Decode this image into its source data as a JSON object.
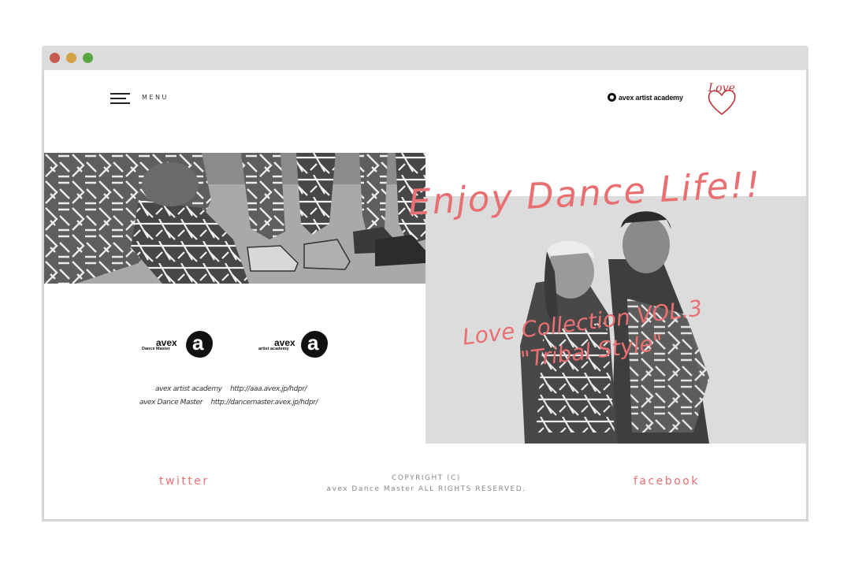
{
  "header": {
    "menu_label": "MENU",
    "brand_text": "avex artist academy",
    "love_logo_text": "Love"
  },
  "hero": {
    "headline": "Enjoy Dance Life!!",
    "collection_line1": "Love Collection VOL.3",
    "collection_line2": "\"Tribal Style\""
  },
  "brands": {
    "dance_master": {
      "word": "avex",
      "sub": "Dance Master",
      "mark": "a"
    },
    "artist_academy": {
      "word": "avex",
      "sub": "artist academy",
      "mark": "a"
    }
  },
  "links": {
    "academy": {
      "name": "avex artist academy",
      "url": "http://aaa.avex.jp/hdpr/"
    },
    "dance_master": {
      "name": "avex Dance Master",
      "url": "http://dancemaster.avex.jp/hdpr/"
    }
  },
  "footer": {
    "twitter": "twitter",
    "facebook": "facebook",
    "copyright_line1": "COPYRIGHT (C)",
    "copyright_line2": "avex Dance Master ALL RIGHTS RESERVED."
  },
  "colors": {
    "accent": "#e86f72",
    "window_chrome": "#dcdcdc",
    "dot_close": "#c65b4f",
    "dot_minimize": "#d3a046",
    "dot_maximize": "#58a643"
  }
}
